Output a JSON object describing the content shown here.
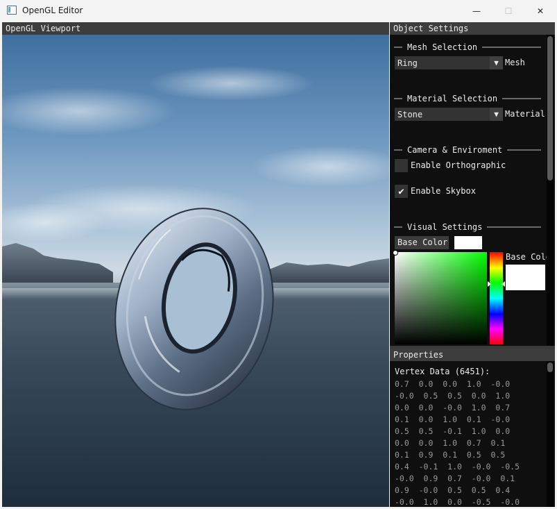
{
  "window": {
    "title": "OpenGL Editor",
    "minimize": "—",
    "maximize": "☐",
    "close": "✕"
  },
  "viewport": {
    "title": "OpenGL Viewport"
  },
  "object_settings": {
    "title": "Object Settings",
    "mesh_section": "Mesh Selection",
    "mesh_value": "Ring",
    "mesh_label": "Mesh",
    "material_section": "Material Selection",
    "material_value": "Stone",
    "material_label": "Material",
    "camera_section": "Camera & Enviroment",
    "orthographic_label": "Enable Orthographic",
    "orthographic_checked": false,
    "skybox_label": "Enable Skybox",
    "skybox_checked": true,
    "visual_section": "Visual Settings",
    "base_color_button": "Base Color",
    "picker_label": "Base Colo",
    "base_color": "#ffffff"
  },
  "properties": {
    "title": "Properties",
    "vertex_title": "Vertex Data (6451):",
    "vertex_rows": [
      "0.7  0.0  0.0  1.0  -0.0",
      "-0.0  0.5  0.5  0.0  1.0",
      "0.0  0.0  -0.0  1.0  0.7",
      "0.1  0.0  1.0  0.1  -0.0",
      "0.5  0.5  -0.1  1.0  0.0",
      "0.0  0.0  1.0  0.7  0.1",
      "0.1  0.9  0.1  0.5  0.5",
      "0.4  -0.1  1.0  -0.0  -0.5",
      "-0.0  0.9  0.7  -0.0  0.1",
      "0.9  -0.0  0.5  0.5  0.4",
      "-0.0  1.0  0.0  -0.5  -0.0"
    ]
  }
}
